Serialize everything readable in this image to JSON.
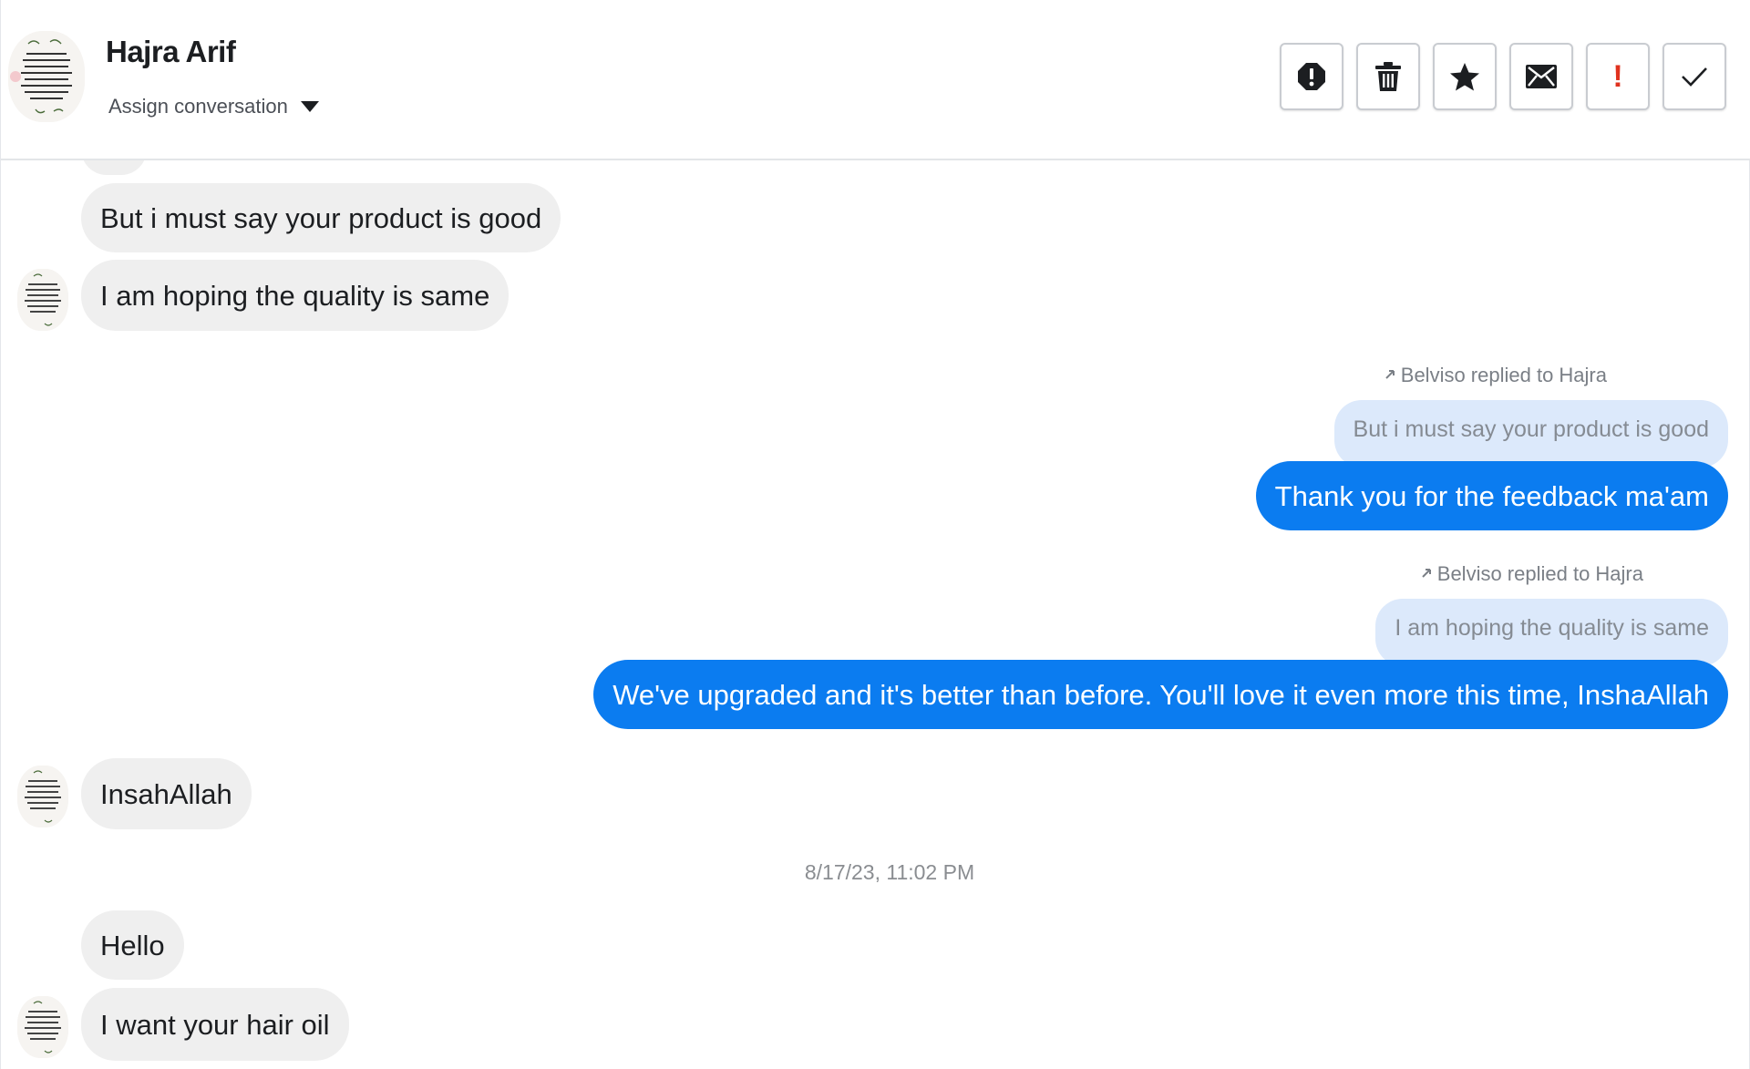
{
  "header": {
    "contact_name": "Hajra Arif",
    "assign_label": "Assign conversation",
    "actions": [
      {
        "name": "spam",
        "icon": "alert-octagon-icon"
      },
      {
        "name": "delete",
        "icon": "trash-icon"
      },
      {
        "name": "star",
        "icon": "star-icon"
      },
      {
        "name": "mark-unread",
        "icon": "envelope-icon"
      },
      {
        "name": "important",
        "icon": "exclamation-icon",
        "glyph": "!"
      },
      {
        "name": "done",
        "icon": "check-icon"
      }
    ]
  },
  "messages": {
    "in_1": "But i must say your product is good",
    "in_2": "I am hoping the quality is same",
    "reply_note_1": "Belviso replied to Hajra",
    "quote_1": "But i must say your product is good",
    "out_1": "Thank you for the feedback ma'am",
    "reply_note_2": "Belviso replied to Hajra",
    "quote_2": "I am hoping the quality is same",
    "out_2": "We've upgraded and it's better than before. You'll love it even more this time, InshaAllah",
    "in_3": "InsahAllah",
    "timestamp": "8/17/23, 11:02 PM",
    "in_4": "Hello",
    "in_5": "I want your hair oil"
  },
  "colors": {
    "outgoing_bubble": "#0b7cf0",
    "incoming_bubble": "#efefef",
    "quoted_bubble": "#dce9fb",
    "important_red": "#e0321f"
  }
}
